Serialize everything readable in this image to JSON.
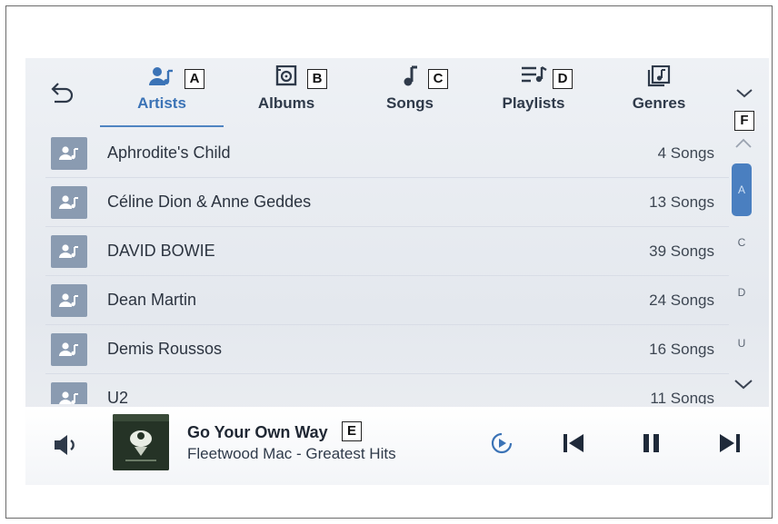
{
  "tabs": [
    {
      "label": "Artists",
      "icon": "artist-icon",
      "callout": "A",
      "active": true
    },
    {
      "label": "Albums",
      "icon": "album-icon",
      "callout": "B"
    },
    {
      "label": "Songs",
      "icon": "note-icon",
      "callout": "C"
    },
    {
      "label": "Playlists",
      "icon": "playlist-icon",
      "callout": "D"
    },
    {
      "label": "Genres",
      "icon": "genre-icon"
    }
  ],
  "artists": [
    {
      "name": "Aphrodite's Child",
      "count": "4 Songs"
    },
    {
      "name": "Céline Dion & Anne Geddes",
      "count": "13 Songs"
    },
    {
      "name": "DAVID BOWIE",
      "count": "39 Songs"
    },
    {
      "name": "Dean Martin",
      "count": "24 Songs"
    },
    {
      "name": "Demis Roussos",
      "count": "16 Songs"
    },
    {
      "name": "U2",
      "count": "11 Songs"
    }
  ],
  "index": {
    "callout": "F",
    "letters": [
      "A",
      "C",
      "D",
      "U"
    ],
    "active_letter": "A"
  },
  "now_playing": {
    "title": "Go Your Own Way",
    "subtitle": "Fleetwood Mac - Greatest Hits",
    "callout": "E"
  },
  "colors": {
    "accent": "#4a7fc0",
    "avatar": "#8a9bb1",
    "text": "#2c3440"
  }
}
